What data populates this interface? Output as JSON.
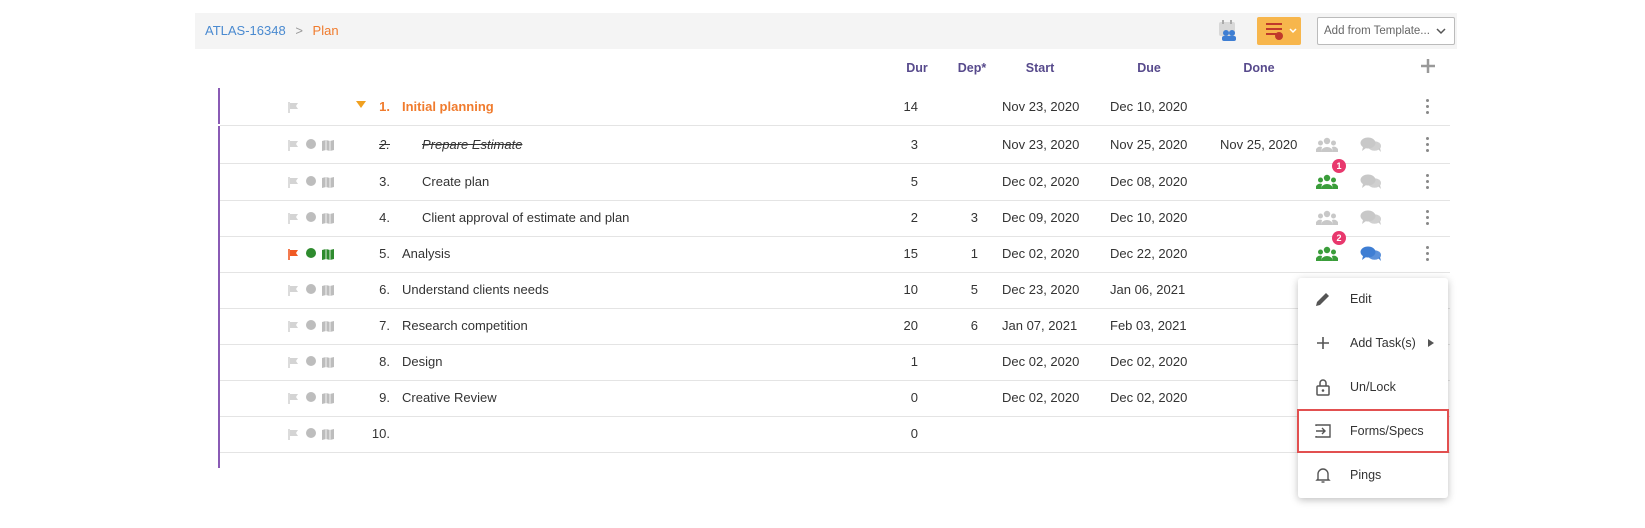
{
  "breadcrumb": {
    "project": "ATLAS-16348",
    "separator": ">",
    "current": "Plan"
  },
  "toolbar": {
    "template_placeholder": "Add from Template..."
  },
  "columns": {
    "dur": "Dur",
    "dep": "Dep*",
    "start": "Start",
    "due": "Due",
    "done": "Done"
  },
  "colors": {
    "accent": "#f07b2d",
    "purple": "#574a8c",
    "green": "#3a9d3a",
    "badge": "#e8386d",
    "blue": "#3e7ed3",
    "flag_active": "#f05a24"
  },
  "rows": [
    {
      "num": "1.",
      "name": "Initial planning",
      "dur": "14",
      "dep": "",
      "start": "Nov 23, 2020",
      "due": "Dec 10, 2020",
      "done": "",
      "group": true
    },
    {
      "num": "2.",
      "name": "Prepare Estimate",
      "dur": "3",
      "dep": "",
      "start": "Nov 23, 2020",
      "due": "Nov 25, 2020",
      "done": "Nov 25, 2020",
      "completed": true
    },
    {
      "num": "3.",
      "name": "Create plan",
      "dur": "5",
      "dep": "",
      "start": "Dec 02, 2020",
      "due": "Dec 08, 2020",
      "done": "",
      "team_badge": "1"
    },
    {
      "num": "4.",
      "name": "Client approval of estimate and plan",
      "dur": "2",
      "dep": "3",
      "start": "Dec 09, 2020",
      "due": "Dec 10, 2020",
      "done": ""
    },
    {
      "num": "5.",
      "name": "Analysis",
      "dur": "15",
      "dep": "1",
      "start": "Dec 02, 2020",
      "due": "Dec 22, 2020",
      "done": "",
      "team_badge": "2"
    },
    {
      "num": "6.",
      "name": "Understand clients needs",
      "dur": "10",
      "dep": "5",
      "start": "Dec 23, 2020",
      "due": "Jan 06, 2021",
      "done": ""
    },
    {
      "num": "7.",
      "name": "Research competition",
      "dur": "20",
      "dep": "6",
      "start": "Jan 07, 2021",
      "due": "Feb 03, 2021",
      "done": ""
    },
    {
      "num": "8.",
      "name": "Design",
      "dur": "1",
      "dep": "",
      "start": "Dec 02, 2020",
      "due": "Dec 02, 2020",
      "done": ""
    },
    {
      "num": "9.",
      "name": "Creative Review",
      "dur": "0",
      "dep": "",
      "start": "Dec 02, 2020",
      "due": "Dec 02, 2020",
      "done": ""
    },
    {
      "num": "10.",
      "name": "",
      "dur": "0",
      "dep": "",
      "start": "",
      "due": "",
      "done": ""
    }
  ],
  "context_menu": {
    "edit": "Edit",
    "add_tasks": "Add Task(s)",
    "unlock": "Un/Lock",
    "forms": "Forms/Specs",
    "pings": "Pings"
  }
}
